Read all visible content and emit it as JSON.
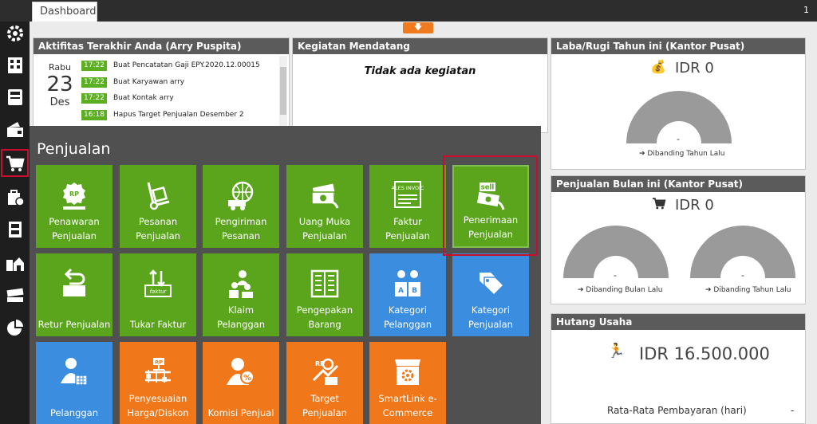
{
  "topbar": {
    "tab_label": "Dashboard",
    "right_indicator": "1"
  },
  "sidebar": {
    "items": [
      {
        "name": "settings",
        "icon": "gear-icon"
      },
      {
        "name": "company",
        "icon": "building-icon"
      },
      {
        "name": "ledger",
        "icon": "ledger-icon"
      },
      {
        "name": "cash-bank",
        "icon": "wallet-icon"
      },
      {
        "name": "sales",
        "icon": "cart-icon",
        "active": true
      },
      {
        "name": "purchase",
        "icon": "bag-icon"
      },
      {
        "name": "inventory",
        "icon": "cabinet-icon"
      },
      {
        "name": "branch",
        "icon": "warehouse-icon"
      },
      {
        "name": "tax",
        "icon": "tax-icon"
      },
      {
        "name": "reports",
        "icon": "pie-chart-icon"
      }
    ],
    "active_color": "#c8102e"
  },
  "activity": {
    "title": "Aktifitas Terakhir Anda (Arry Puspita)",
    "date_day": "Rabu",
    "date_num": "23",
    "date_month": "Des",
    "rows": [
      {
        "time": "17:22",
        "text": "Buat Pencatatan Gaji EPY.2020.12.00015"
      },
      {
        "time": "17:22",
        "text": "Buat Karyawan arry"
      },
      {
        "time": "17:22",
        "text": "Buat Kontak arry"
      },
      {
        "time": "16:18",
        "text": "Hapus Target Penjualan Desember 2"
      }
    ]
  },
  "upcoming": {
    "title": "Kegiatan Mendatang",
    "empty_text": "Tidak ada kegiatan"
  },
  "profit": {
    "title": "Laba/Rugi Tahun ini (Kantor Pusat)",
    "amount": "IDR 0",
    "gauge_value": "-",
    "compare": "➔ Dibanding Tahun Lalu"
  },
  "sales_month": {
    "title": "Penjualan Bulan ini (Kantor Pusat)",
    "amount": "IDR 0",
    "gauge1_value": "-",
    "gauge1_compare": "➔ Dibanding Bulan Lalu",
    "gauge2_value": "-",
    "gauge2_compare": "➔ Dibanding Tahun Lalu"
  },
  "payables": {
    "title": "Hutang Usaha",
    "amount": "IDR 16.500.000",
    "avg_label": "Rata-Rata Pembayaran (hari)",
    "avg_value": "-"
  },
  "sales_menu": {
    "title": "Penjualan",
    "tiles": [
      {
        "label": "Penawaran Penjualan",
        "color": "#5aa51c",
        "icon": "quotation-icon"
      },
      {
        "label": "Pesanan Penjualan",
        "color": "#5aa51c",
        "icon": "hand-truck-icon"
      },
      {
        "label": "Pengiriman Pesanan",
        "color": "#5aa51c",
        "icon": "delivery-truck-icon"
      },
      {
        "label": "Uang Muka Penjualan",
        "color": "#5aa51c",
        "icon": "cash-icon"
      },
      {
        "label": "Faktur Penjualan",
        "color": "#5aa51c",
        "icon": "invoice-icon",
        "icon_text": "SALES INVOICE"
      },
      {
        "label": "Penerimaan Penjualan",
        "color": "#5aa51c",
        "icon": "sell-money-icon",
        "icon_text": "sell",
        "selected": true
      },
      {
        "label": "Retur Penjualan",
        "color": "#5aa51c",
        "icon": "return-box-icon"
      },
      {
        "label": "Tukar Faktur",
        "color": "#5aa51c",
        "icon": "exchange-invoice-icon",
        "icon_text": "faktur"
      },
      {
        "label": "Klaim Pelanggan",
        "color": "#5aa51c",
        "icon": "customer-claim-icon"
      },
      {
        "label": "Pengepakan Barang",
        "color": "#5aa51c",
        "icon": "packing-list-icon"
      },
      {
        "label": "Kategori Pelanggan",
        "color": "#3b8de0",
        "icon": "customer-category-icon"
      },
      {
        "label": "Kategori Penjualan",
        "color": "#3b8de0",
        "icon": "tag-icon"
      },
      {
        "label": "Pelanggan",
        "color": "#3b8de0",
        "icon": "customer-icon"
      },
      {
        "label": "Penyesuaian Harga/Diskon",
        "color": "#f0781a",
        "icon": "price-adjust-icon"
      },
      {
        "label": "Komisi Penjual",
        "color": "#f0781a",
        "icon": "commission-icon"
      },
      {
        "label": "Target Penjualan",
        "color": "#f0781a",
        "icon": "sales-target-icon"
      },
      {
        "label": "SmartLink e-Commerce",
        "color": "#f0781a",
        "icon": "ecommerce-store-icon"
      }
    ],
    "highlight_color": "#c8102e"
  }
}
